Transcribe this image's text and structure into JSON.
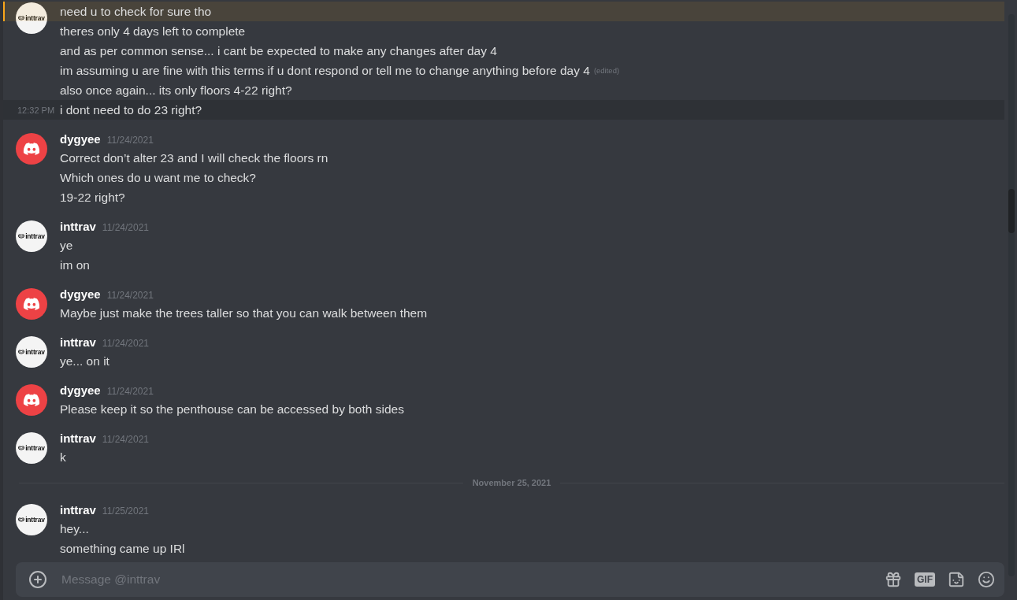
{
  "messages": [
    {
      "kind": "group",
      "avatar": {
        "kind": "text_logo",
        "text": "inttrav"
      },
      "lines": [
        {
          "text": "need u to check for sure tho",
          "highlighted": true
        },
        {
          "text": "theres only 4 days left to complete",
          "highlighted": false
        },
        {
          "text": "and as per common sense... i cant be expected to make any changes after day 4",
          "highlighted": false
        },
        {
          "text": "im assuming u are fine with this terms if u dont respond or tell me to change anything before day 4",
          "edited": "(edited)",
          "highlighted": false
        },
        {
          "text": "also once again... its only floors 4-22 right?",
          "highlighted": false
        },
        {
          "text": "i dont need to do 23 right?",
          "highlighted": false,
          "time": "12:32 PM"
        }
      ]
    },
    {
      "kind": "group",
      "author": "dygyee",
      "timestamp": "11/24/2021",
      "avatar": {
        "kind": "discord"
      },
      "lines": [
        {
          "text": "Correct don’t alter 23 and I will check the floors rn",
          "highlighted": false
        },
        {
          "text": "Which ones do u want me to check?",
          "highlighted": false
        },
        {
          "text": "19-22 right?",
          "highlighted": false
        }
      ]
    },
    {
      "kind": "group",
      "author": "inttrav",
      "timestamp": "11/24/2021",
      "avatar": {
        "kind": "text_logo",
        "text": "inttrav"
      },
      "lines": [
        {
          "text": "ye",
          "highlighted": false
        },
        {
          "text": "im on",
          "highlighted": false
        }
      ]
    },
    {
      "kind": "group",
      "author": "dygyee",
      "timestamp": "11/24/2021",
      "avatar": {
        "kind": "discord"
      },
      "lines": [
        {
          "text": "Maybe just make the trees taller so that you can walk between them",
          "highlighted": false
        }
      ]
    },
    {
      "kind": "group",
      "author": "inttrav",
      "timestamp": "11/24/2021",
      "avatar": {
        "kind": "text_logo",
        "text": "inttrav"
      },
      "lines": [
        {
          "text": "ye... on it",
          "highlighted": false
        }
      ]
    },
    {
      "kind": "group",
      "author": "dygyee",
      "timestamp": "11/24/2021",
      "avatar": {
        "kind": "discord"
      },
      "lines": [
        {
          "text": "Please keep it so the penthouse can be accessed by both sides",
          "highlighted": false
        }
      ]
    },
    {
      "kind": "group",
      "author": "inttrav",
      "timestamp": "11/24/2021",
      "avatar": {
        "kind": "text_logo",
        "text": "inttrav"
      },
      "lines": [
        {
          "text": "k",
          "highlighted": false
        }
      ]
    },
    {
      "kind": "divider",
      "label": "November 25, 2021"
    },
    {
      "kind": "group",
      "author": "inttrav",
      "timestamp": "11/25/2021",
      "avatar": {
        "kind": "text_logo",
        "text": "inttrav"
      },
      "lines": [
        {
          "text": "hey...",
          "highlighted": false
        },
        {
          "text": "something came up IRl",
          "highlighted": false
        }
      ]
    }
  ],
  "composer": {
    "placeholder": "Message @inttrav",
    "gif_label": "GIF"
  }
}
